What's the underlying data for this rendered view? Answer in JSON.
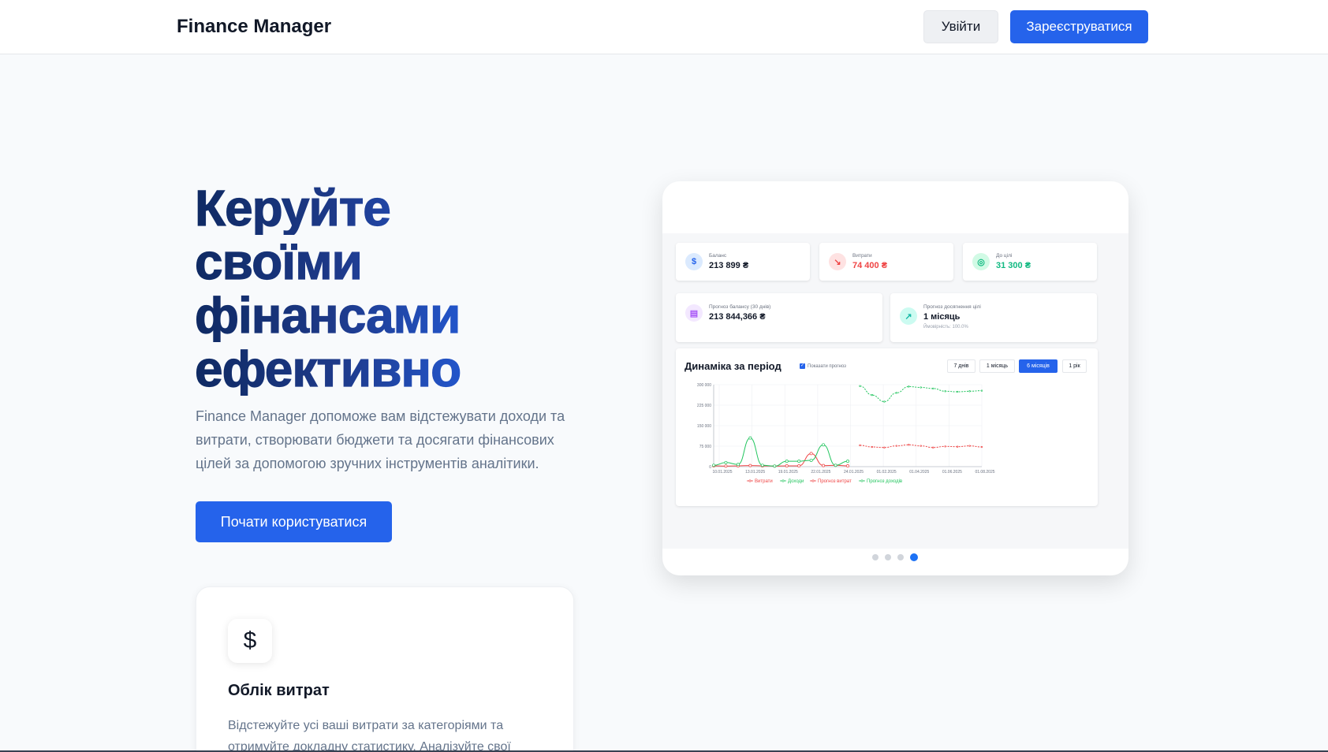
{
  "header": {
    "brand": "Finance Manager",
    "login_label": "Увійти",
    "signup_label": "Зареєструватися"
  },
  "hero": {
    "title_lines": [
      "Керуйте",
      "своїми",
      "фінансами",
      "ефективно"
    ],
    "description": "Finance Manager допоможе вам відстежувати доходи та витрати, створювати бюджети та досягати фінансових цілей за допомогою зручних інструментів аналітики.",
    "cta_label": "Почати користуватися"
  },
  "feature": {
    "icon": "dollar-icon",
    "icon_glyph": "$",
    "title": "Облік витрат",
    "text": "Відстежуйте усі ваші витрати за категоріями та отримуйте докладну статистику. Аналізуйте свої"
  },
  "preview": {
    "stats": [
      {
        "label": "Баланс",
        "value": "213 899 ₴",
        "color": "#111827",
        "icon": "dollar-icon",
        "glyph": "$"
      },
      {
        "label": "Витрати",
        "value": "74 400 ₴",
        "color": "#ef4444",
        "icon": "trend-down-icon",
        "glyph": "↘"
      },
      {
        "label": "До цілі",
        "value": "31 300 ₴",
        "color": "#10b981",
        "icon": "target-icon",
        "glyph": "◎"
      }
    ],
    "forecast_balance": {
      "label": "Прогноз балансу (30 днів)",
      "value": "213 844,366 ₴",
      "glyph": "▤"
    },
    "forecast_goal": {
      "label": "Прогноз досягнення цілі",
      "value": "1 місяць",
      "sub": "Ймовірність: 100.0%",
      "glyph": "↗"
    },
    "chart_title": "Динаміка за період",
    "forecast_toggle": "Показати прогноз",
    "periods": [
      "7 днів",
      "1 місяць",
      "6 місяців",
      "1 рік"
    ],
    "active_period": "6 місяців",
    "carousel_dots": 4,
    "carousel_active": 4
  },
  "chart_data": {
    "type": "line",
    "y_ticks": [
      "300 000",
      "225 000",
      "150 000",
      "75 000",
      "0"
    ],
    "ylim": [
      0,
      300000
    ],
    "x_ticks": [
      "10.01.2025",
      "13.01.2025",
      "19.01.2025",
      "22.01.2025",
      "24.01.2025",
      "01.02.2025",
      "01.04.2025",
      "01.06.2025",
      "01.08.2025"
    ],
    "series": [
      {
        "name": "Витрати",
        "color": "#ef4444",
        "dashed": false,
        "x": [
          0,
          1,
          2,
          3,
          4,
          5,
          6,
          7,
          8,
          9,
          10,
          11
        ],
        "values": [
          3000,
          2000,
          3000,
          4000,
          3000,
          2000,
          3000,
          3000,
          48000,
          4000,
          5000,
          3000
        ]
      },
      {
        "name": "Доходи",
        "color": "#22c55e",
        "dashed": false,
        "x": [
          0,
          1,
          2,
          3,
          4,
          5,
          6,
          7,
          8,
          9,
          10,
          11
        ],
        "values": [
          5000,
          15000,
          8000,
          105000,
          5000,
          2000,
          20000,
          20000,
          23000,
          80000,
          5000,
          20000
        ]
      },
      {
        "name": "Прогноз витрат",
        "color": "#ef4444",
        "dashed": true,
        "x": [
          12,
          13,
          14,
          15,
          16,
          17,
          18,
          19,
          20,
          21,
          22
        ],
        "values": [
          78000,
          72000,
          70000,
          76000,
          80000,
          76000,
          70000,
          74000,
          73000,
          76000,
          72000
        ]
      },
      {
        "name": "Прогноз доходів",
        "color": "#22c55e",
        "dashed": true,
        "x": [
          12,
          13,
          14,
          15,
          16,
          17,
          18,
          19,
          20,
          21,
          22
        ],
        "values": [
          295000,
          262000,
          238000,
          270000,
          293000,
          290000,
          286000,
          276000,
          274000,
          276000,
          278000
        ]
      }
    ]
  }
}
